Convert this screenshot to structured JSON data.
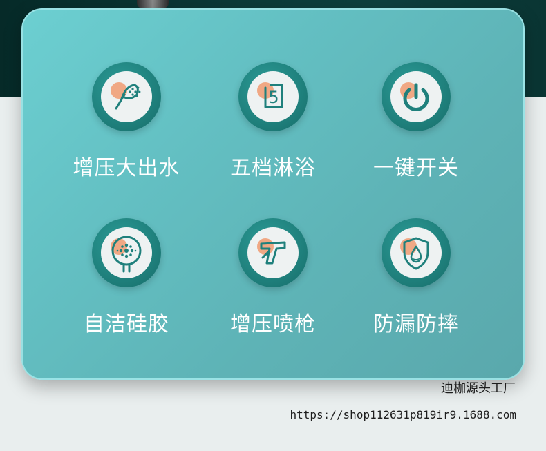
{
  "features": [
    {
      "label": "增压大出水",
      "icon": "shower-head-icon"
    },
    {
      "label": "五档淋浴",
      "icon": "five-mode-icon"
    },
    {
      "label": "一键开关",
      "icon": "power-icon"
    },
    {
      "label": "自洁硅胶",
      "icon": "silicone-nozzle-icon"
    },
    {
      "label": "增压喷枪",
      "icon": "spray-gun-icon"
    },
    {
      "label": "防漏防摔",
      "icon": "shield-drop-icon"
    }
  ],
  "five_mode_digit": "5",
  "footer": {
    "factory": "迪枷源头工厂",
    "url": "https://shop112631p819ir9.1688.com"
  },
  "colors": {
    "card": "#63bfc2",
    "ring": "#1f807c",
    "accent": "#f0a27b",
    "icon_stroke": "#1f807c"
  }
}
